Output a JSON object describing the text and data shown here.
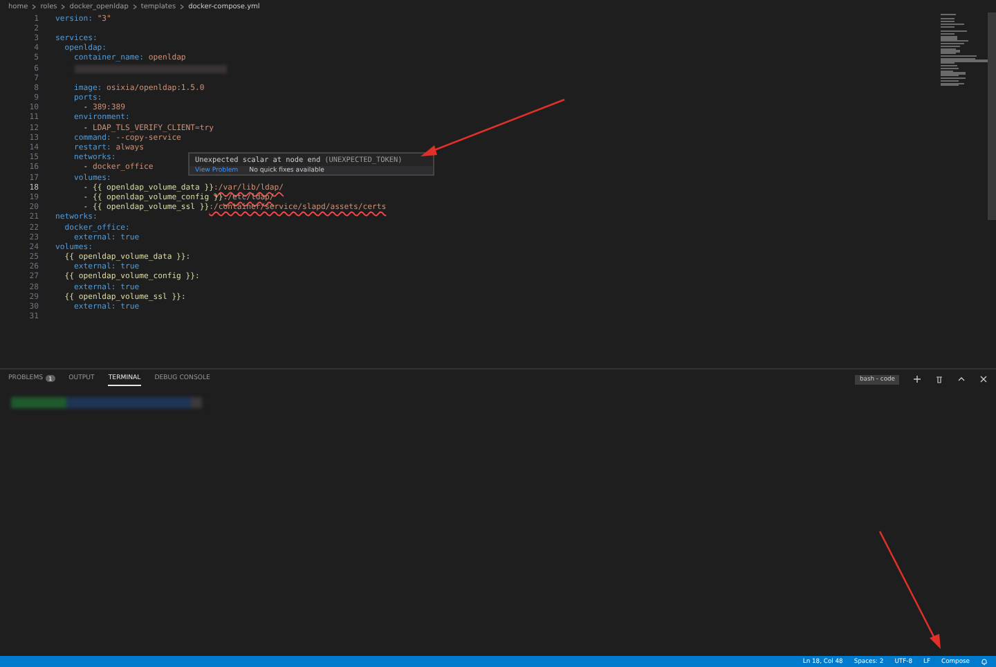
{
  "breadcrumb": [
    "home",
    "roles",
    "docker_openldap",
    "templates",
    "docker-compose.yml"
  ],
  "editor": {
    "lines": [
      {
        "num": "1",
        "current": false,
        "tokens": [
          {
            "text": "version: ",
            "kind": "key"
          },
          {
            "text": "\"3\"",
            "kind": "string"
          }
        ]
      },
      {
        "num": "2",
        "current": false
      },
      {
        "num": "3",
        "current": false,
        "tokens": [
          {
            "text": "services:",
            "kind": "key"
          }
        ]
      },
      {
        "num": "4",
        "current": false,
        "tokens": [
          {
            "text": "  openldap:",
            "kind": "key"
          }
        ]
      },
      {
        "num": "5",
        "current": false,
        "tokens": [
          {
            "text": "    container_name: ",
            "kind": "key"
          },
          {
            "text": "openldap",
            "kind": "string"
          }
        ]
      },
      {
        "num": "6",
        "current": false,
        "tokens": [
          {
            "kind": "redacted"
          }
        ]
      },
      {
        "num": "7",
        "current": false
      },
      {
        "num": "8",
        "current": false,
        "tokens": [
          {
            "text": "    image: ",
            "kind": "key"
          },
          {
            "text": "osixia/openldap:1.5.0",
            "kind": "string"
          }
        ]
      },
      {
        "num": "9",
        "current": false,
        "tokens": [
          {
            "text": "    ports:",
            "kind": "key"
          }
        ]
      },
      {
        "num": "10",
        "current": false,
        "tokens": [
          {
            "text": "      -",
            "kind": "plain"
          },
          {
            "text": " 389:389",
            "kind": "string"
          }
        ]
      },
      {
        "num": "11",
        "current": false,
        "tokens": [
          {
            "text": "    environment:",
            "kind": "key"
          }
        ]
      },
      {
        "num": "12",
        "current": false,
        "tokens": [
          {
            "text": "      -",
            "kind": "plain"
          },
          {
            "text": " LDAP_TLS_VERIFY_CLIENT=try",
            "kind": "string"
          }
        ]
      },
      {
        "num": "13",
        "current": false,
        "tokens": [
          {
            "text": "    command: ",
            "kind": "key"
          },
          {
            "text": "--copy-service",
            "kind": "string"
          }
        ]
      },
      {
        "num": "14",
        "current": false,
        "tokens": [
          {
            "text": "    restart: ",
            "kind": "key"
          },
          {
            "text": "always",
            "kind": "string"
          }
        ]
      },
      {
        "num": "15",
        "current": false,
        "tokens": [
          {
            "text": "    networks:",
            "kind": "key"
          }
        ]
      },
      {
        "num": "16",
        "current": false,
        "tokens": [
          {
            "text": "      -",
            "kind": "plain"
          },
          {
            "text": " docker_office",
            "kind": "string"
          }
        ]
      },
      {
        "num": "17",
        "current": false,
        "tokens": [
          {
            "text": "    volumes:",
            "kind": "key"
          }
        ]
      },
      {
        "num": "18",
        "current": true,
        "tokens": [
          {
            "text": "      -",
            "kind": "plain"
          },
          {
            "text": " {{ openldap_volume_data }}",
            "kind": "template"
          },
          {
            "text": ":/var/lib/ldap/",
            "kind": "error"
          }
        ]
      },
      {
        "num": "19",
        "current": false,
        "tokens": [
          {
            "text": "      -",
            "kind": "plain"
          },
          {
            "text": " {{ openldap_volume_config }}",
            "kind": "template"
          },
          {
            "text": ":/etc/ldap/",
            "kind": "error"
          }
        ]
      },
      {
        "num": "20",
        "current": false,
        "tokens": [
          {
            "text": "      -",
            "kind": "plain"
          },
          {
            "text": " {{ openldap_volume_ssl }}",
            "kind": "template"
          },
          {
            "text": ":/container/service/slapd/assets/certs",
            "kind": "error"
          }
        ]
      },
      {
        "num": "21",
        "current": false,
        "tokens": [
          {
            "text": "networks:",
            "kind": "key"
          }
        ]
      },
      {
        "num": "22",
        "current": false,
        "tokens": [
          {
            "text": "  docker_office:",
            "kind": "key"
          }
        ]
      },
      {
        "num": "23",
        "current": false,
        "tokens": [
          {
            "text": "    external: ",
            "kind": "key"
          },
          {
            "text": "true",
            "kind": "keyword"
          }
        ]
      },
      {
        "num": "24",
        "current": false,
        "tokens": [
          {
            "text": "volumes:",
            "kind": "key"
          }
        ]
      },
      {
        "num": "25",
        "current": false,
        "tokens": [
          {
            "text": "  {{ openldap_volume_data }}",
            "kind": "template"
          },
          {
            "text": ":",
            "kind": "plain"
          }
        ]
      },
      {
        "num": "26",
        "current": false,
        "tokens": [
          {
            "text": "    external: ",
            "kind": "key"
          },
          {
            "text": "true",
            "kind": "keyword"
          }
        ]
      },
      {
        "num": "27",
        "current": false,
        "tokens": [
          {
            "text": "  {{ openldap_volume_config }}",
            "kind": "template"
          },
          {
            "text": ":",
            "kind": "plain"
          }
        ]
      },
      {
        "num": "28",
        "current": false,
        "tokens": [
          {
            "text": "    external: ",
            "kind": "key"
          },
          {
            "text": "true",
            "kind": "keyword"
          }
        ]
      },
      {
        "num": "29",
        "current": false,
        "tokens": [
          {
            "text": "  {{ openldap_volume_ssl }}",
            "kind": "template"
          },
          {
            "text": ":",
            "kind": "plain"
          }
        ]
      },
      {
        "num": "30",
        "current": false,
        "tokens": [
          {
            "text": "    external: ",
            "kind": "key"
          },
          {
            "text": "true",
            "kind": "keyword"
          }
        ]
      },
      {
        "num": "31",
        "current": false
      }
    ]
  },
  "hover": {
    "message": "Unexpected scalar at node end",
    "code": "(UNEXPECTED_TOKEN)",
    "action": "View Problem",
    "note": "No quick fixes available"
  },
  "panel": {
    "tabs": [
      {
        "label": "PROBLEMS",
        "badge": "1",
        "selected": false
      },
      {
        "label": "OUTPUT",
        "selected": false
      },
      {
        "label": "TERMINAL",
        "selected": true
      },
      {
        "label": "DEBUG CONSOLE",
        "selected": false
      }
    ],
    "terminal_label": "bash - code"
  },
  "status_bar": [
    "Ln 18, Col 48",
    "Spaces: 2",
    "UTF-8",
    "LF",
    "Compose"
  ]
}
